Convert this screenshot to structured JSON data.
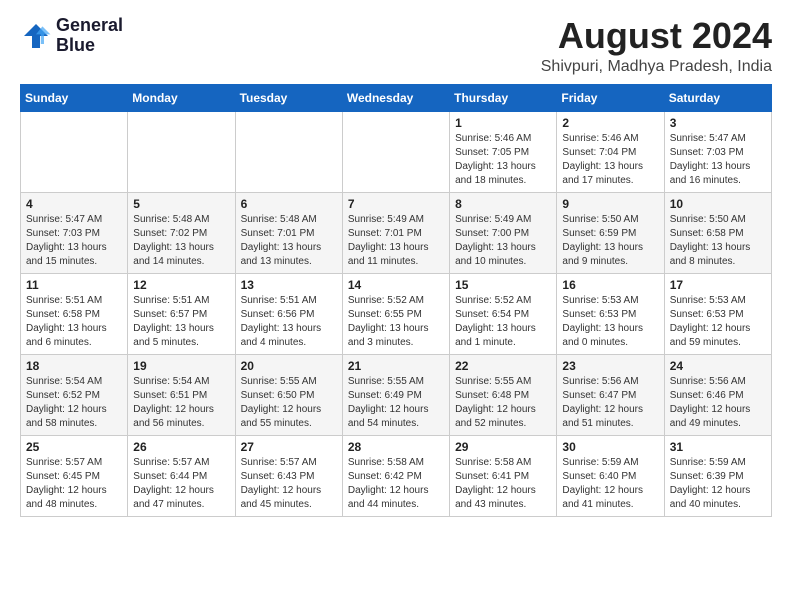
{
  "header": {
    "logo_line1": "General",
    "logo_line2": "Blue",
    "month_year": "August 2024",
    "location": "Shivpuri, Madhya Pradesh, India"
  },
  "days_of_week": [
    "Sunday",
    "Monday",
    "Tuesday",
    "Wednesday",
    "Thursday",
    "Friday",
    "Saturday"
  ],
  "weeks": [
    [
      {
        "day": "",
        "info": ""
      },
      {
        "day": "",
        "info": ""
      },
      {
        "day": "",
        "info": ""
      },
      {
        "day": "",
        "info": ""
      },
      {
        "day": "1",
        "info": "Sunrise: 5:46 AM\nSunset: 7:05 PM\nDaylight: 13 hours\nand 18 minutes."
      },
      {
        "day": "2",
        "info": "Sunrise: 5:46 AM\nSunset: 7:04 PM\nDaylight: 13 hours\nand 17 minutes."
      },
      {
        "day": "3",
        "info": "Sunrise: 5:47 AM\nSunset: 7:03 PM\nDaylight: 13 hours\nand 16 minutes."
      }
    ],
    [
      {
        "day": "4",
        "info": "Sunrise: 5:47 AM\nSunset: 7:03 PM\nDaylight: 13 hours\nand 15 minutes."
      },
      {
        "day": "5",
        "info": "Sunrise: 5:48 AM\nSunset: 7:02 PM\nDaylight: 13 hours\nand 14 minutes."
      },
      {
        "day": "6",
        "info": "Sunrise: 5:48 AM\nSunset: 7:01 PM\nDaylight: 13 hours\nand 13 minutes."
      },
      {
        "day": "7",
        "info": "Sunrise: 5:49 AM\nSunset: 7:01 PM\nDaylight: 13 hours\nand 11 minutes."
      },
      {
        "day": "8",
        "info": "Sunrise: 5:49 AM\nSunset: 7:00 PM\nDaylight: 13 hours\nand 10 minutes."
      },
      {
        "day": "9",
        "info": "Sunrise: 5:50 AM\nSunset: 6:59 PM\nDaylight: 13 hours\nand 9 minutes."
      },
      {
        "day": "10",
        "info": "Sunrise: 5:50 AM\nSunset: 6:58 PM\nDaylight: 13 hours\nand 8 minutes."
      }
    ],
    [
      {
        "day": "11",
        "info": "Sunrise: 5:51 AM\nSunset: 6:58 PM\nDaylight: 13 hours\nand 6 minutes."
      },
      {
        "day": "12",
        "info": "Sunrise: 5:51 AM\nSunset: 6:57 PM\nDaylight: 13 hours\nand 5 minutes."
      },
      {
        "day": "13",
        "info": "Sunrise: 5:51 AM\nSunset: 6:56 PM\nDaylight: 13 hours\nand 4 minutes."
      },
      {
        "day": "14",
        "info": "Sunrise: 5:52 AM\nSunset: 6:55 PM\nDaylight: 13 hours\nand 3 minutes."
      },
      {
        "day": "15",
        "info": "Sunrise: 5:52 AM\nSunset: 6:54 PM\nDaylight: 13 hours\nand 1 minute."
      },
      {
        "day": "16",
        "info": "Sunrise: 5:53 AM\nSunset: 6:53 PM\nDaylight: 13 hours\nand 0 minutes."
      },
      {
        "day": "17",
        "info": "Sunrise: 5:53 AM\nSunset: 6:53 PM\nDaylight: 12 hours\nand 59 minutes."
      }
    ],
    [
      {
        "day": "18",
        "info": "Sunrise: 5:54 AM\nSunset: 6:52 PM\nDaylight: 12 hours\nand 58 minutes."
      },
      {
        "day": "19",
        "info": "Sunrise: 5:54 AM\nSunset: 6:51 PM\nDaylight: 12 hours\nand 56 minutes."
      },
      {
        "day": "20",
        "info": "Sunrise: 5:55 AM\nSunset: 6:50 PM\nDaylight: 12 hours\nand 55 minutes."
      },
      {
        "day": "21",
        "info": "Sunrise: 5:55 AM\nSunset: 6:49 PM\nDaylight: 12 hours\nand 54 minutes."
      },
      {
        "day": "22",
        "info": "Sunrise: 5:55 AM\nSunset: 6:48 PM\nDaylight: 12 hours\nand 52 minutes."
      },
      {
        "day": "23",
        "info": "Sunrise: 5:56 AM\nSunset: 6:47 PM\nDaylight: 12 hours\nand 51 minutes."
      },
      {
        "day": "24",
        "info": "Sunrise: 5:56 AM\nSunset: 6:46 PM\nDaylight: 12 hours\nand 49 minutes."
      }
    ],
    [
      {
        "day": "25",
        "info": "Sunrise: 5:57 AM\nSunset: 6:45 PM\nDaylight: 12 hours\nand 48 minutes."
      },
      {
        "day": "26",
        "info": "Sunrise: 5:57 AM\nSunset: 6:44 PM\nDaylight: 12 hours\nand 47 minutes."
      },
      {
        "day": "27",
        "info": "Sunrise: 5:57 AM\nSunset: 6:43 PM\nDaylight: 12 hours\nand 45 minutes."
      },
      {
        "day": "28",
        "info": "Sunrise: 5:58 AM\nSunset: 6:42 PM\nDaylight: 12 hours\nand 44 minutes."
      },
      {
        "day": "29",
        "info": "Sunrise: 5:58 AM\nSunset: 6:41 PM\nDaylight: 12 hours\nand 43 minutes."
      },
      {
        "day": "30",
        "info": "Sunrise: 5:59 AM\nSunset: 6:40 PM\nDaylight: 12 hours\nand 41 minutes."
      },
      {
        "day": "31",
        "info": "Sunrise: 5:59 AM\nSunset: 6:39 PM\nDaylight: 12 hours\nand 40 minutes."
      }
    ]
  ]
}
